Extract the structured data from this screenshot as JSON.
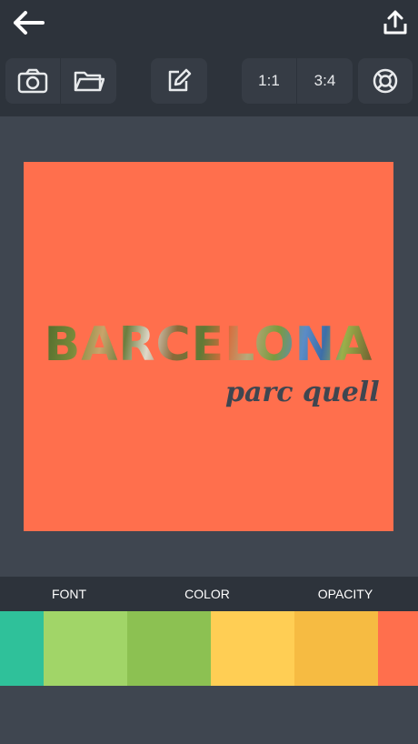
{
  "header": {
    "back_icon": "arrow-left-icon",
    "share_icon": "share-upload-icon"
  },
  "toolbar": {
    "camera_icon": "camera-icon",
    "folder_icon": "folder-icon",
    "edit_icon": "edit-pencil-icon",
    "ratio_square_label": "1:1",
    "ratio_portrait_label": "3:4",
    "lifebuoy_icon": "lifebuoy-icon"
  },
  "canvas": {
    "background_color": "#ff6f4d",
    "title": "BARCELONA",
    "subtitle": "parc quell"
  },
  "tabs": [
    {
      "label": "FONT"
    },
    {
      "label": "COLOR"
    },
    {
      "label": "OPACITY"
    }
  ],
  "palette": [
    "#2fc19a",
    "#a1d568",
    "#8cc152",
    "#ffce54",
    "#f6bb42",
    "#ff6f4d"
  ],
  "colors": {
    "bar": "#2d333b",
    "workspace": "#3f4650",
    "button": "#363c45"
  }
}
